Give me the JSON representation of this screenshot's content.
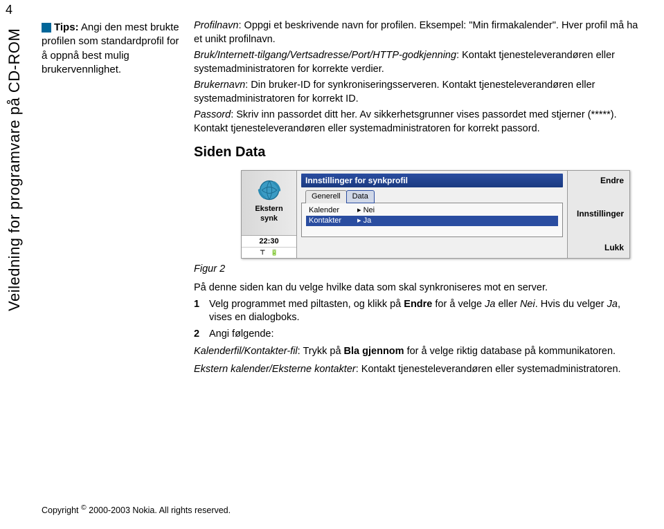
{
  "page_number": "4",
  "vertical_title": "Veiledning for programvare på CD-ROM",
  "tip": {
    "label": "Tips:",
    "text": " Angi den mest brukte profilen som standardprofil for å oppnå best mulig brukervennlighet."
  },
  "defs": {
    "profilnavn_term": "Profilnavn",
    "profilnavn_text": ": Oppgi et beskrivende navn for profilen. Eksempel: \"Min firmakalender\". Hver profil må ha et unikt profilnavn.",
    "bruk_term": "Bruk/Internett-tilgang/Vertsadresse/Port/HTTP-godkjenning",
    "bruk_text": ": Kontakt tjenesteleverandøren eller systemadministratoren for korrekte verdier.",
    "brukernavn_term": "Brukernavn",
    "brukernavn_text": ": Din bruker-ID for synkroniseringsserveren. Kontakt tjenesteleverandøren eller systemadministratoren for korrekt ID.",
    "passord_term": "Passord",
    "passord_text": ": Skriv inn passordet ditt her. Av sikkerhetsgrunner vises passordet med stjerner (*****). Kontakt tjenesteleverandøren eller systemadministratoren for korrekt passord."
  },
  "section_title": "Siden Data",
  "figure": {
    "caption": "Figur 2",
    "left_label_1": "Ekstern",
    "left_label_2": "synk",
    "clock": "22:30",
    "title": "Innstillinger for synkprofil",
    "tab_generell": "Generell",
    "tab_data": "Data",
    "row_kalender_label": "Kalender",
    "row_kalender_value": "Nei",
    "row_kontakter_label": "Kontakter",
    "row_kontakter_value": "Ja",
    "btn_endre": "Endre",
    "btn_innstillinger": "Innstillinger",
    "btn_lukk": "Lukk"
  },
  "body": {
    "intro": "På denne siden kan du velge hvilke data som skal synkroniseres mot en server.",
    "step1_pre": "Velg programmet med piltasten, og klikk på ",
    "step1_bold": "Endre",
    "step1_mid": " for å velge ",
    "step1_ja": "Ja",
    "step1_eller": " eller ",
    "step1_nei": "Nei",
    "step1_post": ". Hvis du velger ",
    "step1_ja2": "Ja",
    "step1_end": ", vises en dialogboks.",
    "step2": "Angi følgende:",
    "kalenderfil_term": "Kalenderfil/Kontakter-fil",
    "kalenderfil_pre": ": Trykk på ",
    "kalenderfil_bold": "Bla gjennom",
    "kalenderfil_post": " for å velge riktig database på kommunikatoren.",
    "ekstern_term": "Ekstern kalender/Eksterne kontakter",
    "ekstern_text": ": Kontakt tjenesteleverandøren eller systemadministratoren."
  },
  "copyright_pre": "Copyright ",
  "copyright_post": " 2000-2003 Nokia. All rights reserved."
}
